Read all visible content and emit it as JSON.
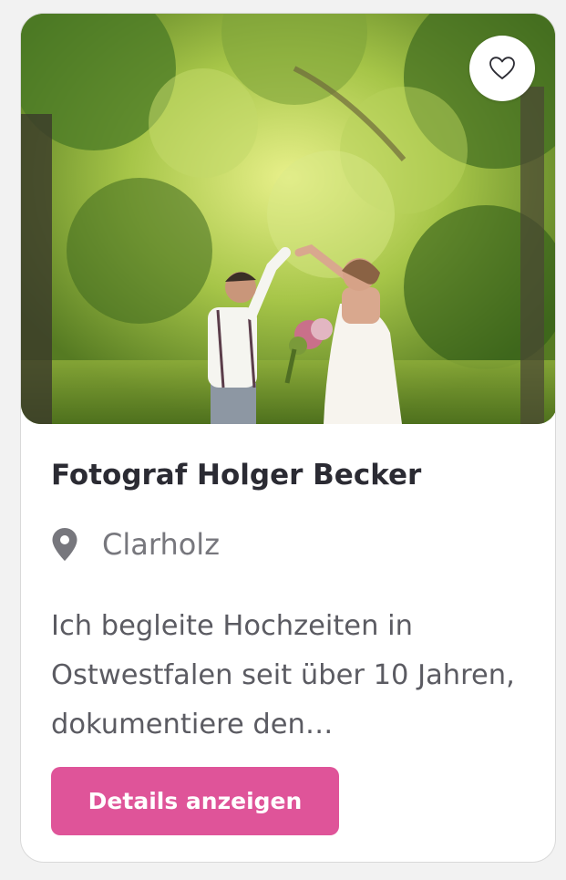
{
  "listing": {
    "title": "Fotograf Holger Becker",
    "location": "Clarholz",
    "description": "Ich begleite Hochzeiten in Ostwestfalen seit über 10 Jahren, dokumentiere den…",
    "cta_label": "Details anzeigen",
    "favorite_icon": "heart-outline-icon",
    "location_icon": "map-pin-icon"
  },
  "colors": {
    "accent": "#df5499",
    "title": "#2b2b33",
    "muted": "#77777d",
    "body": "#5b5b62"
  }
}
